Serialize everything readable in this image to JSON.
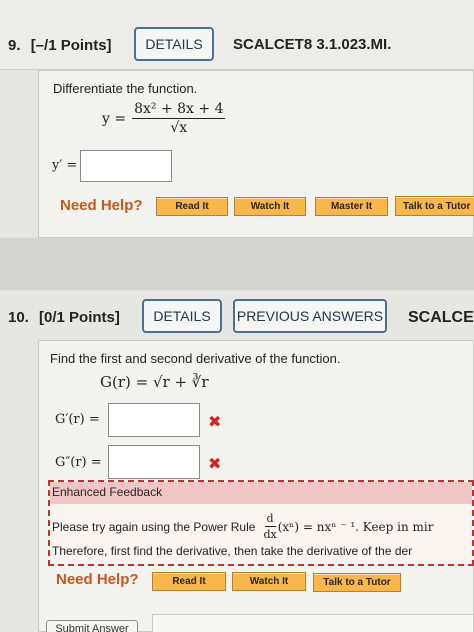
{
  "q9": {
    "number": "9.",
    "points": "[–/1 Points]",
    "details_label": "DETAILS",
    "code": "SCALCET8 3.1.023.MI.",
    "prompt": "Differentiate the function.",
    "lhs": "y =",
    "numerator": "8x² + 8x + 4",
    "denominator": "√x",
    "answer_label": "y′ =",
    "answer_value": ""
  },
  "help9": {
    "label": "Need Help?",
    "buttons": [
      "Read It",
      "Watch It",
      "Master It",
      "Talk to a Tutor"
    ]
  },
  "q10": {
    "number": "10.",
    "points": "[0/1 Points]",
    "details_label": "DETAILS",
    "previous_label": "PREVIOUS ANSWERS",
    "code": "SCALCET",
    "prompt": "Find the first and second derivative of the function.",
    "function": "G(r) = √r + ∛r",
    "first_label": "G′(r)  =",
    "second_label": "G″(r)  =",
    "first_value": "",
    "second_value": "",
    "wrong_mark": "✖"
  },
  "feedback": {
    "title": "Enhanced Feedback",
    "line1_prefix": "Please try again using the Power Rule",
    "rule_num": "d",
    "rule_den": "dx",
    "rule_rest": "(xⁿ) = nxⁿ ⁻ ¹.  Keep in mir",
    "line2": "Therefore, first find the derivative, then take the derivative of the der"
  },
  "help10": {
    "label": "Need Help?",
    "buttons": [
      "Read It",
      "Watch It",
      "Talk to a Tutor"
    ]
  },
  "submit_label": "Submit Answer"
}
